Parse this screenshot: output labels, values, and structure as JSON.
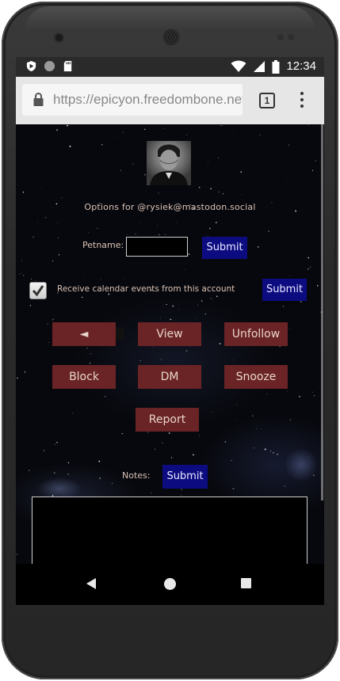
{
  "status_bar": {
    "time": "12:34",
    "left_icons": [
      "shield-notification-icon",
      "circle-notification-icon",
      "sd-card-icon"
    ],
    "right_icons": [
      "wifi-icon",
      "cellular-signal-icon",
      "battery-icon"
    ]
  },
  "browser": {
    "url": "https://epicyon.freedombone.net/users/...",
    "tab_count": "1",
    "menu_icon": "more-vert-icon"
  },
  "profile_options": {
    "options_title": "Options for @rysiek@mastodon.social",
    "petname_label": "Petname:",
    "petname_value": "",
    "petname_submit": "Submit",
    "calendar_checked": true,
    "calendar_label": "Receive calendar events from this account",
    "calendar_submit": "Submit",
    "buttons": {
      "back": "◄",
      "view": "View",
      "unfollow": "Unfollow",
      "block": "Block",
      "dm": "DM",
      "snooze": "Snooze",
      "report": "Report"
    },
    "notes_label": "Notes:",
    "notes_submit": "Submit",
    "notes_value": ""
  },
  "colors": {
    "button_red": "#6a2425",
    "button_blue": "#0c0b80",
    "text_beige": "#d9c2b6"
  }
}
